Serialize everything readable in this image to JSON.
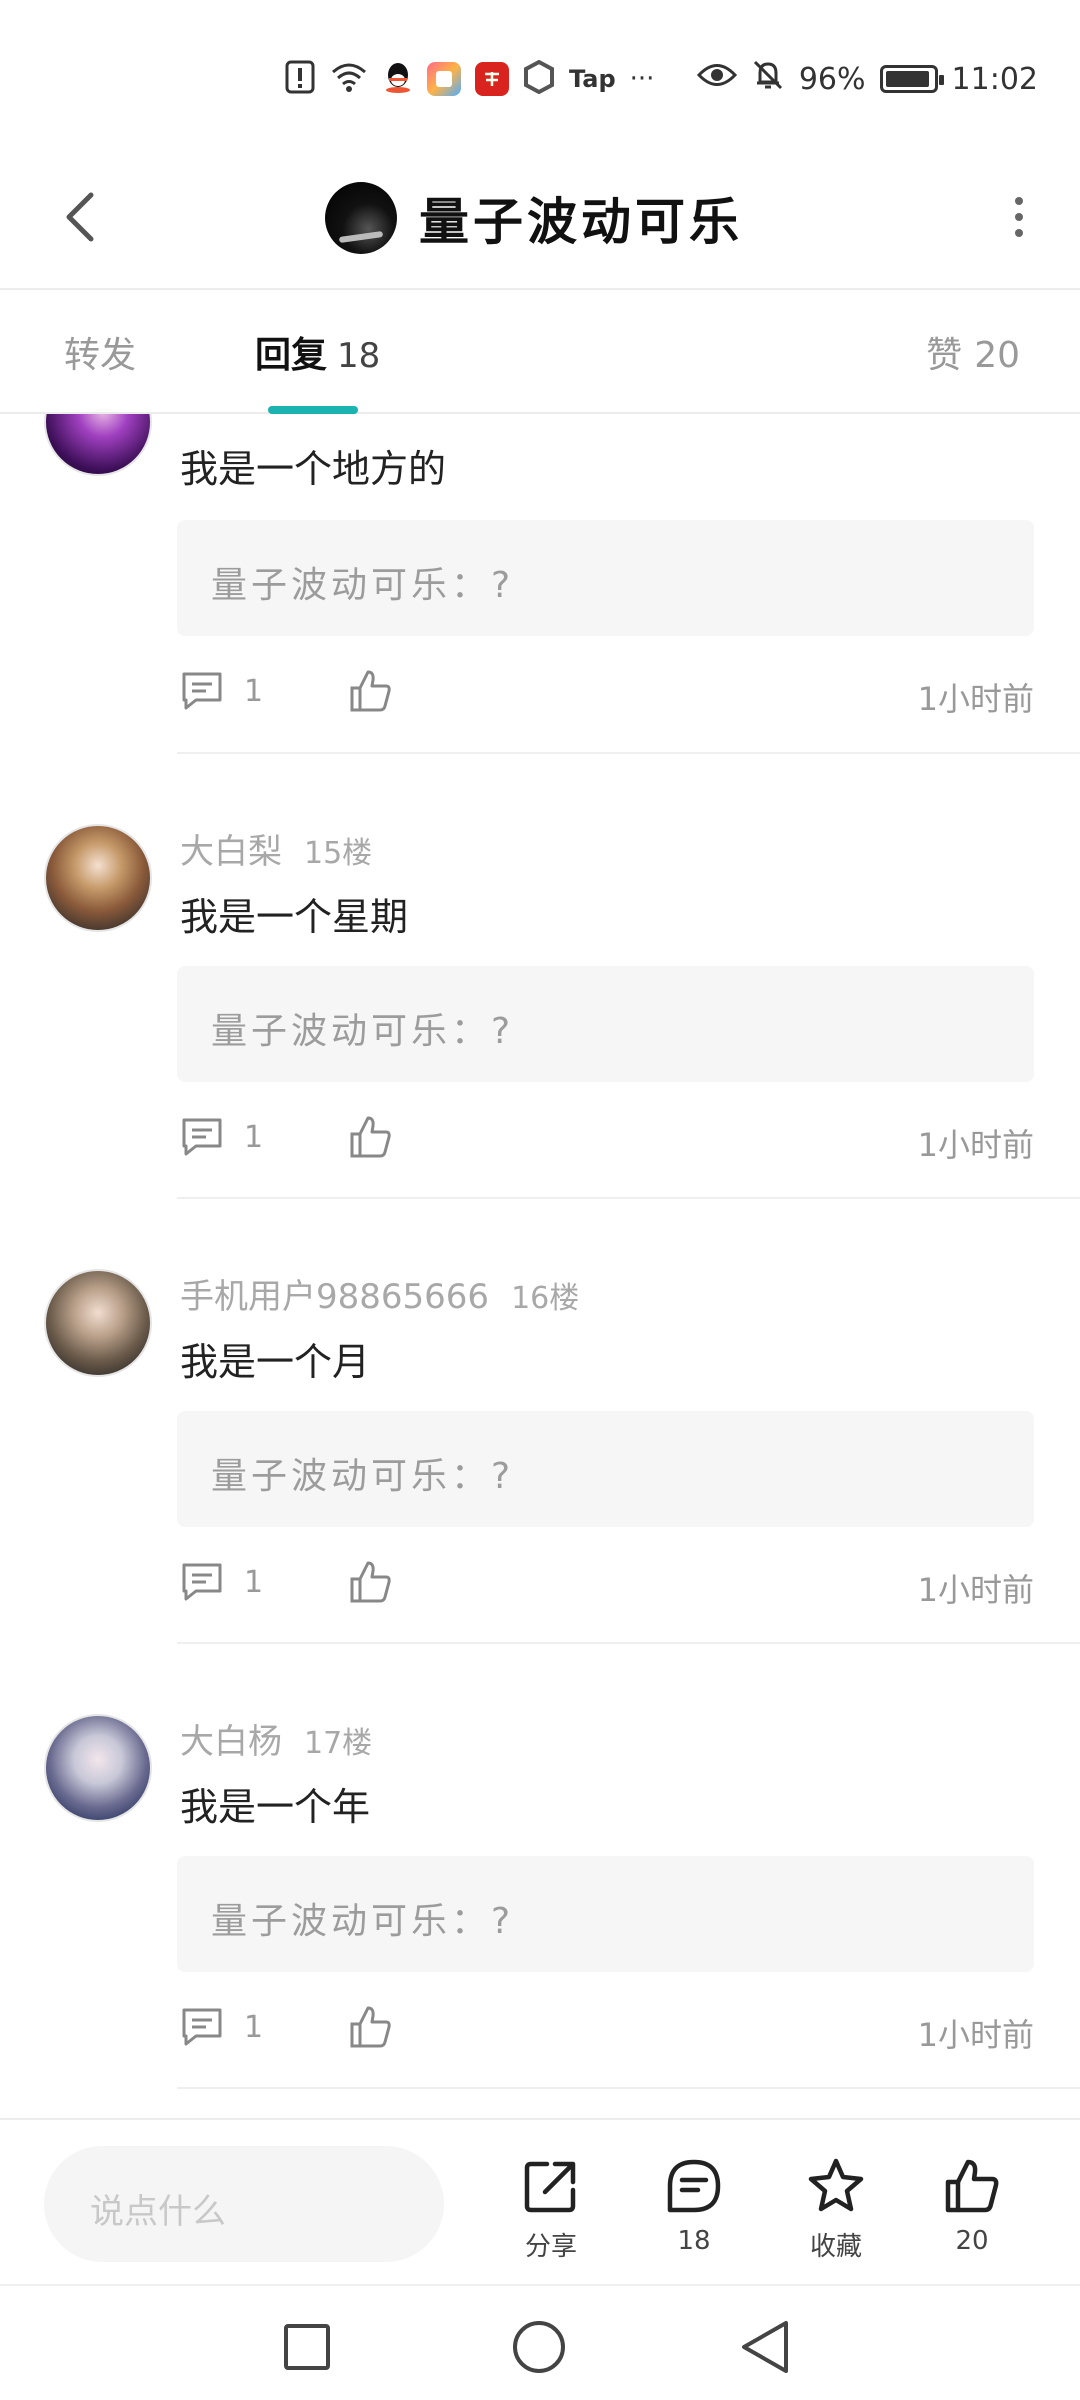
{
  "status_bar": {
    "app_icons": [
      "alert-icon",
      "wifi-icon",
      "qq-icon",
      "app-icon",
      "xuexi-icon",
      "tap-icon"
    ],
    "tap_label": "Tap",
    "more": "···",
    "battery": "96%",
    "time": "11:02"
  },
  "header": {
    "title": "量子波动可乐"
  },
  "tabs": {
    "forward": "转发",
    "reply_label": "回复",
    "reply_count": "18",
    "like_label": "赞",
    "like_count": "20"
  },
  "comments": [
    {
      "user": "",
      "floor": "",
      "text": "我是一个地方的",
      "quote": "量子波动可乐：?",
      "reply_count": "1",
      "time": "1小时前"
    },
    {
      "user": "大白梨",
      "floor": "15楼",
      "text": "我是一个星期",
      "quote": "量子波动可乐：?",
      "reply_count": "1",
      "time": "1小时前"
    },
    {
      "user": "手机用户98865666",
      "floor": "16楼",
      "text": "我是一个月",
      "quote": "量子波动可乐：?",
      "reply_count": "1",
      "time": "1小时前"
    },
    {
      "user": "大白杨",
      "floor": "17楼",
      "text": "我是一个年",
      "quote": "量子波动可乐：?",
      "reply_count": "1",
      "time": "1小时前"
    }
  ],
  "bottom_bar": {
    "input_placeholder": "说点什么",
    "share_label": "分享",
    "comment_count": "18",
    "favorite_label": "收藏",
    "like_count": "20"
  },
  "colors": {
    "accent": "#1ab3b0",
    "text_primary": "#222222",
    "text_secondary": "#999999",
    "quote_bg": "#f6f6f6"
  }
}
